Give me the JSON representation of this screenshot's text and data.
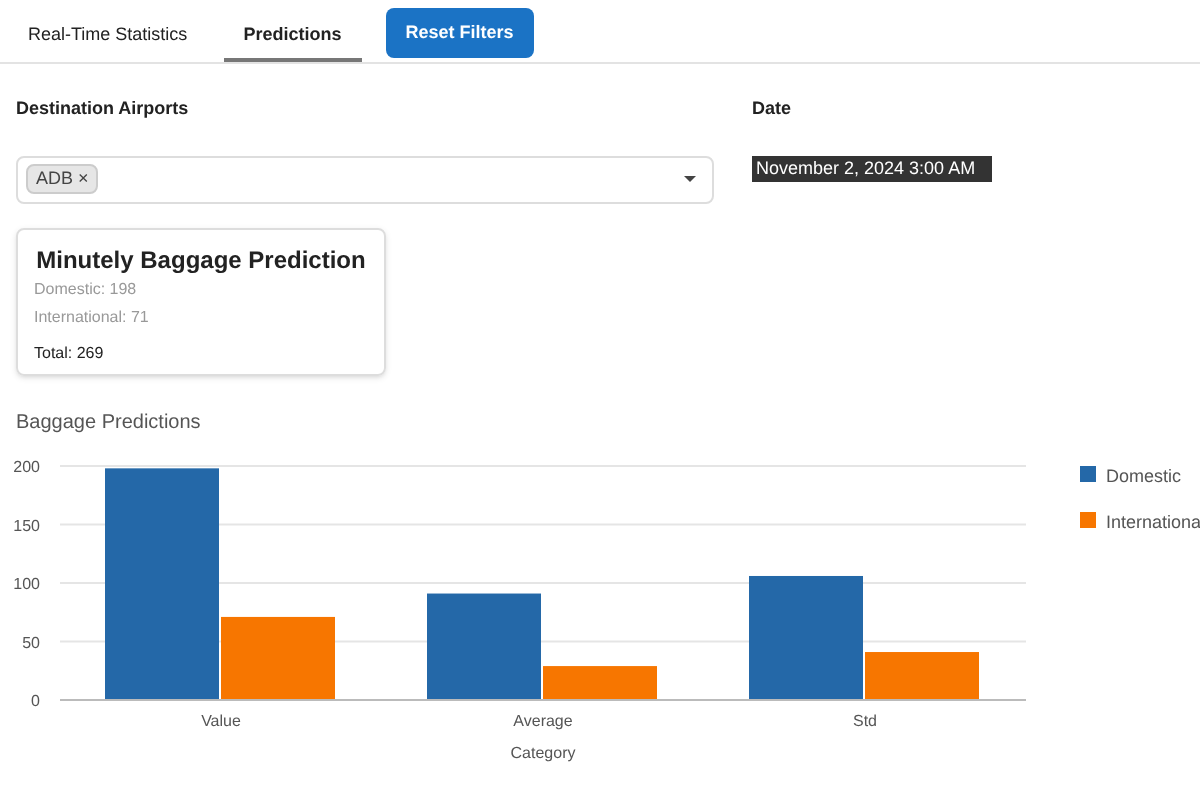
{
  "tabs": [
    {
      "label": "Real-Time Statistics",
      "selected": false
    },
    {
      "label": "Predictions",
      "selected": true
    }
  ],
  "reset_button": "Reset Filters",
  "filters": {
    "airports_label": "Destination Airports",
    "airports_chips": [
      "ADB"
    ],
    "chip_remove": "×",
    "date_label": "Date",
    "date_value": "November 2, 2024 3:00 AM"
  },
  "card": {
    "title": "Minutely Baggage Prediction",
    "domestic": "Domestic: 198",
    "international": "International: 71",
    "total": "Total: 269"
  },
  "chart_title": "Baggage Predictions",
  "chart_data": {
    "type": "bar",
    "xlabel": "Category",
    "categories": [
      "Value",
      "Average",
      "Std"
    ],
    "series": [
      {
        "name": "Domestic",
        "color": "#2468a8",
        "values": [
          198,
          91,
          106
        ]
      },
      {
        "name": "Internationa",
        "color": "#f77600",
        "values": [
          71,
          29,
          41
        ]
      }
    ],
    "ylim": [
      0,
      200
    ],
    "grid": true,
    "legend": true,
    "yticks": [
      0,
      50,
      100,
      150,
      200
    ]
  }
}
